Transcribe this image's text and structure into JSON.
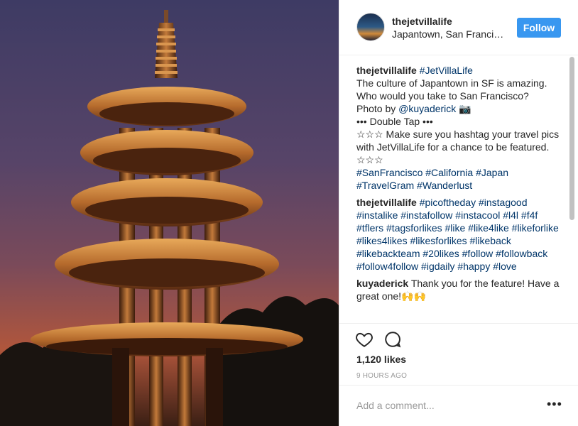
{
  "post": {
    "username": "thejetvillalife",
    "location": "Japantown, San Francisco",
    "follow_label": "Follow",
    "caption": {
      "user": "thejetvillalife",
      "hashtag": "#JetVillaLife",
      "line1": "The culture of Japantown in SF is amazing. Who would you take to San Francisco?",
      "photo_by": "Photo by ",
      "photo_user": "@kuyaderick",
      "camera": "📷",
      "double_tap": "••• Double Tap •••",
      "stars_text": "☆☆☆ Make sure you hashtag your travel pics with JetVillaLife for a chance to be featured. ☆☆☆",
      "tags": "#SanFrancisco #California #Japan #TravelGram #Wanderlust"
    },
    "comment2": {
      "user": "thejetvillalife",
      "tags": "#picoftheday #instagood #instalike #instafollow #instacool #l4l #f4f #tflers #tagsforlikes #like #like4like #likeforlike #likes4likes #likesforlikes #likeback #likebackteam #20likes #follow #followback #follow4follow #igdaily #happy #love"
    },
    "comment3": {
      "user": "kuyaderick",
      "text": "Thank you for the feature! Have a great one!🙌🙌"
    },
    "likes": "1,120 likes",
    "time": "9 HOURS AGO",
    "add_comment_placeholder": "Add a comment...",
    "more_label": "•••"
  }
}
